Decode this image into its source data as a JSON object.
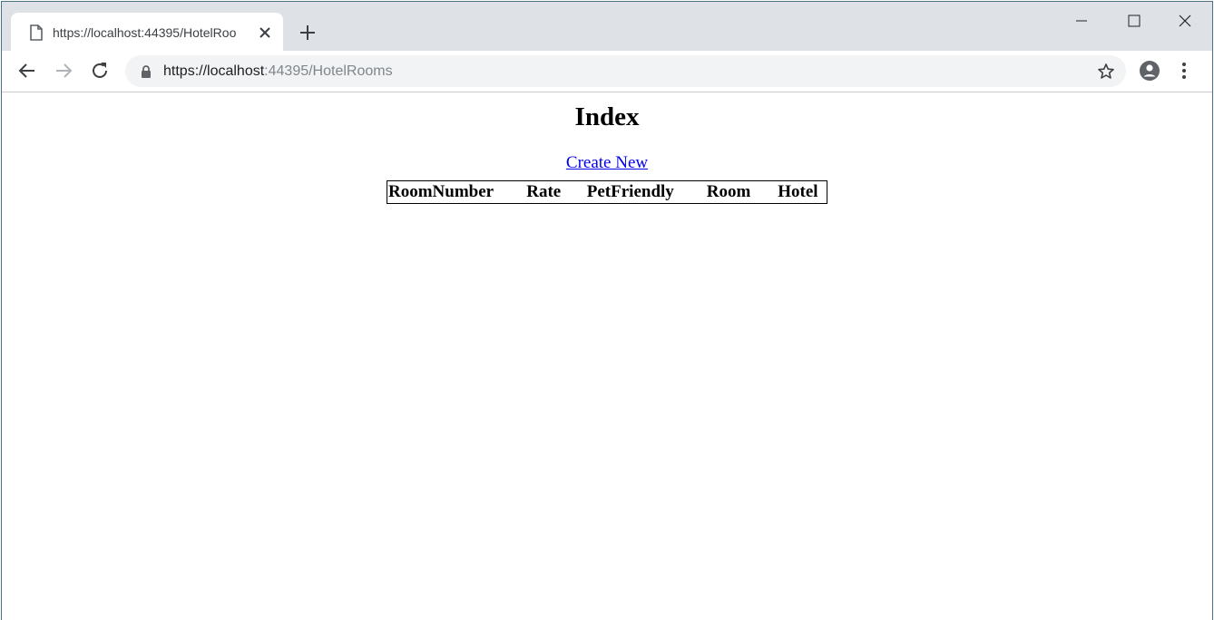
{
  "browser": {
    "tab": {
      "title": "https://localhost:44395/HotelRoo",
      "close_icon": "close-icon",
      "page_icon": "page-icon"
    },
    "new_tab_icon": "plus-icon",
    "window_controls": [
      "minimize-icon",
      "maximize-icon",
      "close-icon"
    ],
    "nav": [
      "back-arrow-icon",
      "forward-arrow-icon",
      "reload-icon"
    ],
    "url": {
      "scheme_host": "https://localhost",
      "rest": ":44395/HotelRooms"
    },
    "omnibox_icons": [
      "lock-icon",
      "star-icon"
    ],
    "right_icons": [
      "profile-icon",
      "menu-dots-icon"
    ]
  },
  "page": {
    "title": "Index",
    "create_link": "Create New",
    "table": {
      "columns": [
        "RoomNumber",
        "Rate",
        "PetFriendly",
        "Room",
        "Hotel"
      ],
      "rows": []
    }
  },
  "colors": {
    "titlebar": "#dee1e6",
    "omnibox": "#f1f3f4",
    "link": "#0000ee"
  }
}
